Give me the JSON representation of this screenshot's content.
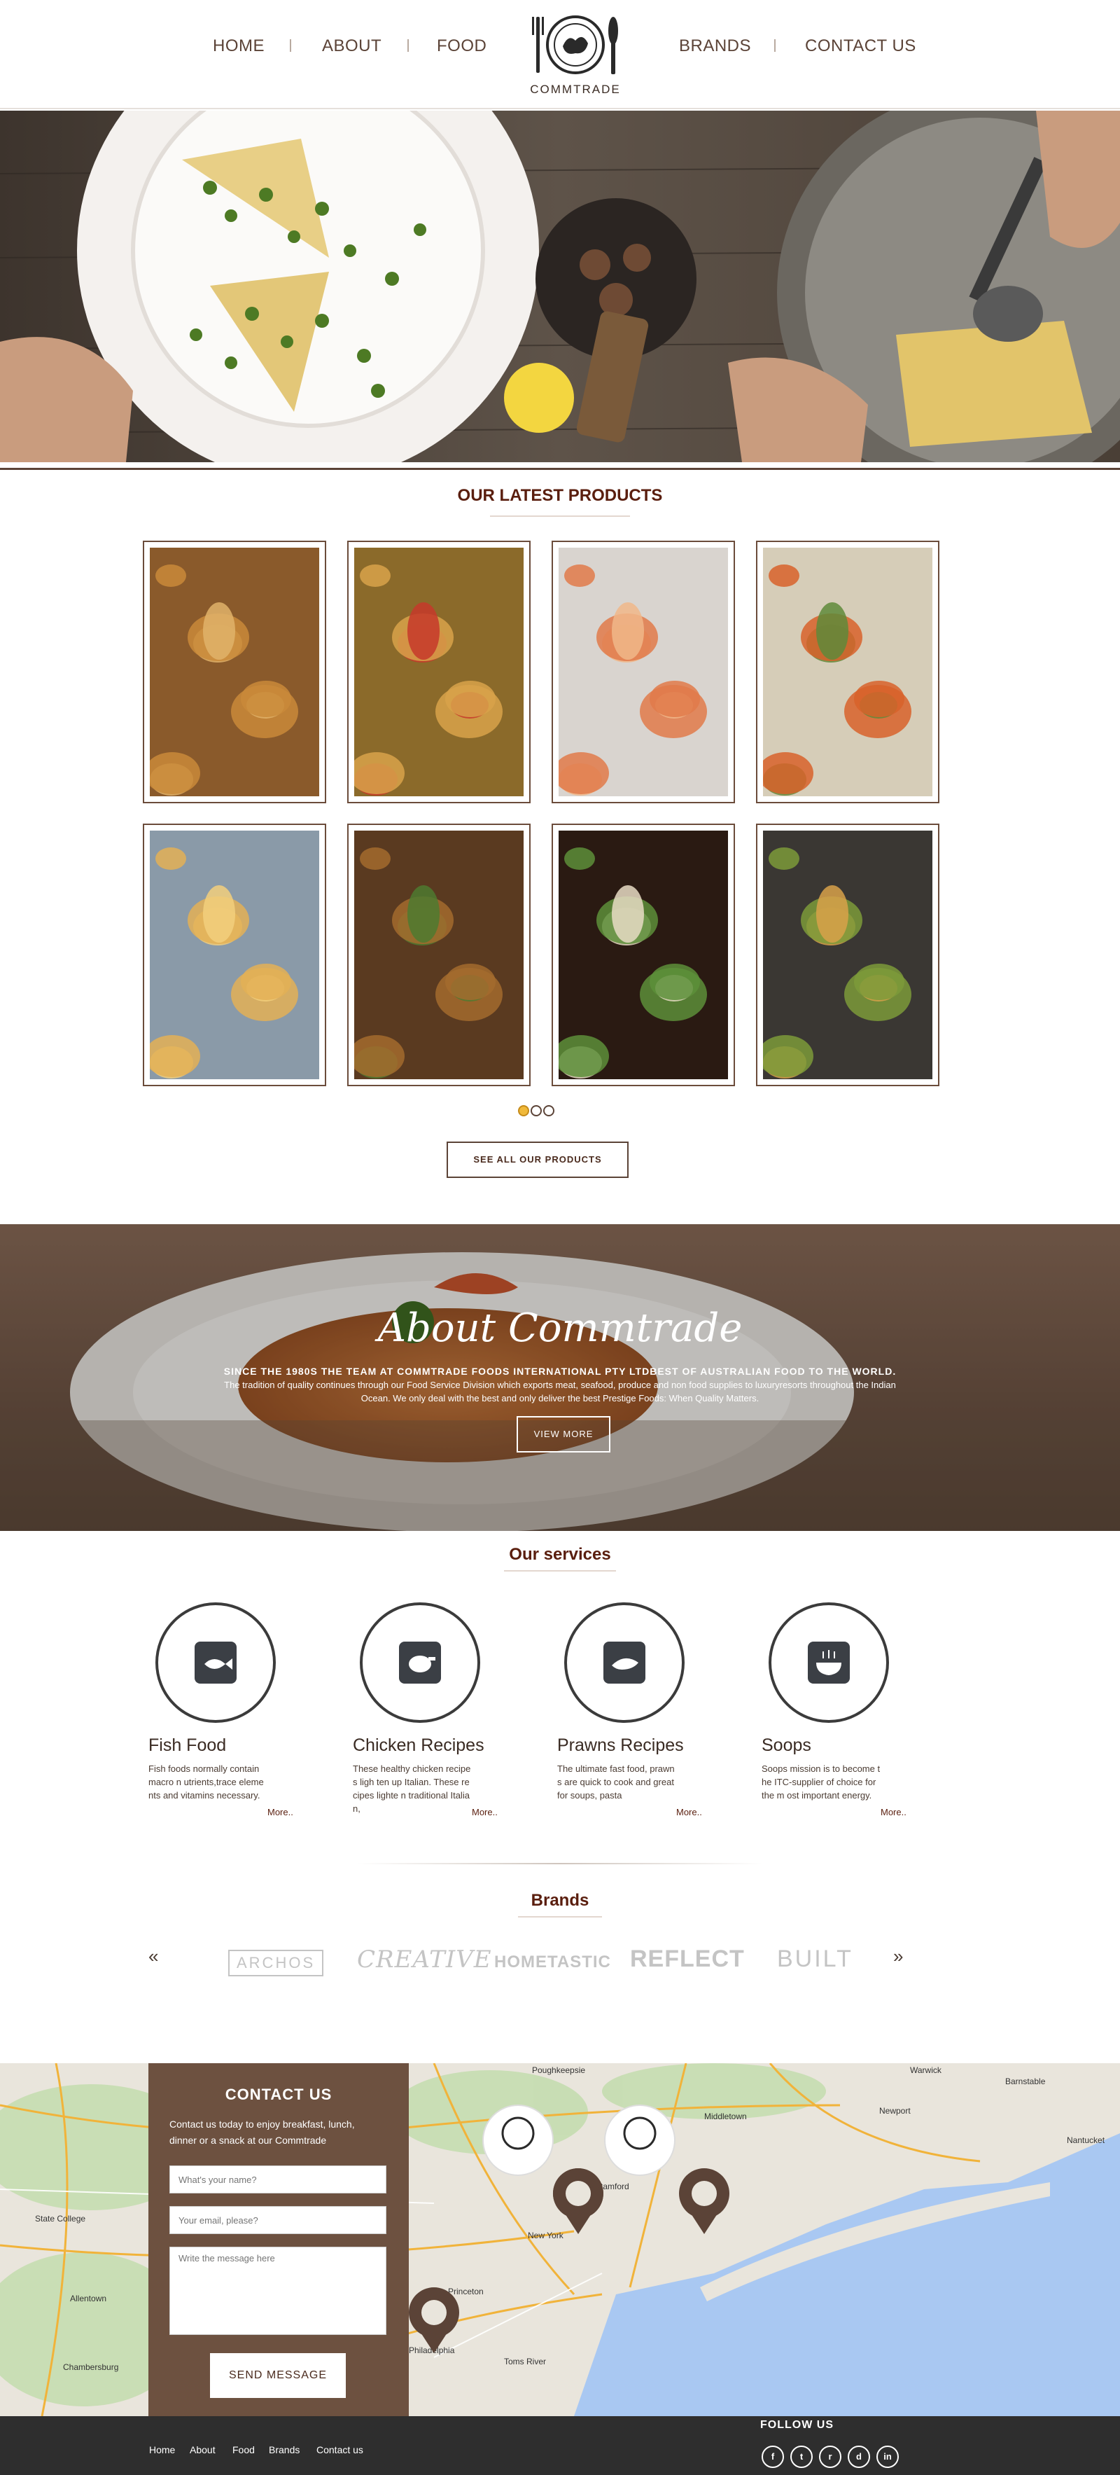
{
  "nav": {
    "home": "HOME",
    "about": "ABOUT",
    "food": "FOOD",
    "brands": "BRANDS",
    "contact": "CONTACT US"
  },
  "logo": {
    "text": "COMMTRADE"
  },
  "products": {
    "title": "OUR LATEST PRODUCTS",
    "items": [
      {
        "subject": "calamari and prawns"
      },
      {
        "subject": "beans and tomato"
      },
      {
        "subject": "prawn soup"
      },
      {
        "subject": "crab and potato"
      },
      {
        "subject": "fish and chips"
      },
      {
        "subject": "fried calamari"
      },
      {
        "subject": "salad wrap"
      },
      {
        "subject": "grilled fish"
      }
    ],
    "carousel_page": 1,
    "carousel_total": 3,
    "button": "SEE ALL OUR PRODUCTS"
  },
  "about": {
    "title": "About Commtrade",
    "lead": "SINCE THE 1980S THE TEAM AT COMMTRADE FOODS INTERNATIONAL PTY LTDBEST OF AUSTRALIAN FOOD TO THE WORLD.",
    "body": "The tradition of quality continues through our Food Service Division which exports meat, seafood, produce and non food supplies to luxuryresorts throughout the Indian Ocean. We only deal with the best and only deliver the best Prestige Foods: When Quality Matters.",
    "button": "VIEW MORE"
  },
  "services": {
    "title": "Our services",
    "items": [
      {
        "icon": "fish-icon",
        "title": "Fish Food",
        "text": "Fish foods normally contain macro n utrients,trace elements and vitamins necessary.",
        "more": "More.."
      },
      {
        "icon": "chicken-icon",
        "title": "Chicken  Recipes",
        "text": "These healthy chicken recipes ligh ten up Italian. These recipes lighte n traditional Italian,",
        "more": "More.."
      },
      {
        "icon": "prawn-icon",
        "title": "Prawns Recipes",
        "text": "The ultimate fast food, prawns are quick to cook and great for soups, pasta",
        "more": "More.."
      },
      {
        "icon": "soup-bowl-icon",
        "title": "Soops",
        "text": "Soops mission is to become the ITC-supplier of choice for the m ost important energy.",
        "more": "More.."
      }
    ]
  },
  "brands": {
    "title": "Brands",
    "prev": "«",
    "next": "»",
    "items": [
      "ARCHOS",
      "CREATIVE",
      "HOMETASTIC",
      "REFLECT",
      "BUILT"
    ]
  },
  "contact": {
    "title": "CONTACT US",
    "intro": "Contact us today to enjoy breakfast, lunch, dinner or a snack at our Commtrade",
    "name_placeholder": "What's your name?",
    "email_placeholder": "Your email, please?",
    "message_placeholder": "Write the message here",
    "button": "SEND MESSAGE"
  },
  "map": {
    "labels": [
      "Poughkeepsie",
      "Middletown",
      "Warwick",
      "Newport",
      "Barnstable",
      "Nantucket",
      "New York",
      "Stamford",
      "Princeton",
      "Philadelphia",
      "Chambersburg",
      "State College",
      "Allentown",
      "Toms River"
    ]
  },
  "footer": {
    "links": [
      "Home",
      "About",
      "Food",
      "Brands",
      "Contact us"
    ],
    "follow": "FOLLOW US",
    "social": [
      {
        "icon": "facebook-icon",
        "glyph": "f"
      },
      {
        "icon": "twitter-icon",
        "glyph": "t"
      },
      {
        "icon": "rss-icon",
        "glyph": "r"
      },
      {
        "icon": "dribbble-icon",
        "glyph": "d"
      },
      {
        "icon": "linkedin-icon",
        "glyph": "in"
      }
    ]
  },
  "colors": {
    "brand_brown": "#5b4337",
    "heading_maroon": "#5a1e0e",
    "contact_panel": "#6d5140",
    "footer_bg": "#2e2e2e"
  }
}
